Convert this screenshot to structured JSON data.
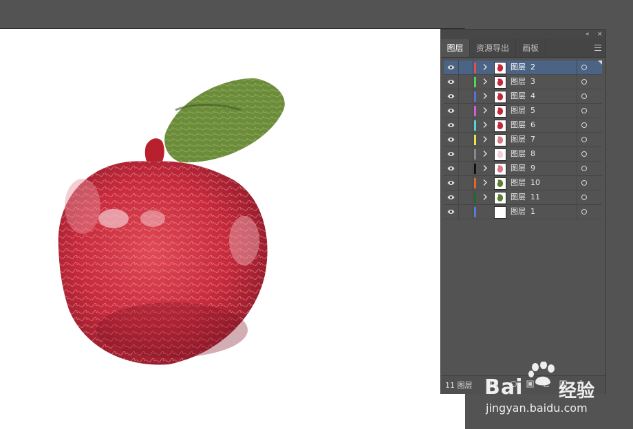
{
  "panel": {
    "controls": {
      "collapse": "«",
      "close": "×"
    },
    "tabs": [
      {
        "label": "图层",
        "active": true
      },
      {
        "label": "资源导出",
        "active": false
      },
      {
        "label": "画板",
        "active": false
      }
    ],
    "layers": [
      {
        "name": "图层  2",
        "color": "#e0524d",
        "selected": true,
        "expand": true,
        "thumb": "red"
      },
      {
        "name": "图层  3",
        "color": "#4fd84f",
        "selected": false,
        "expand": true,
        "thumb": "red"
      },
      {
        "name": "图层  4",
        "color": "#5a6fd8",
        "selected": false,
        "expand": true,
        "thumb": "red"
      },
      {
        "name": "图层  5",
        "color": "#d65bd8",
        "selected": false,
        "expand": true,
        "thumb": "red"
      },
      {
        "name": "图层  6",
        "color": "#4fd8d8",
        "selected": false,
        "expand": true,
        "thumb": "red"
      },
      {
        "name": "图层  7",
        "color": "#e6e64a",
        "selected": false,
        "expand": true,
        "thumb": "pink"
      },
      {
        "name": "图层  8",
        "color": "#8a8a8a",
        "selected": false,
        "expand": true,
        "thumb": "faint"
      },
      {
        "name": "图层  9",
        "color": "#111111",
        "selected": false,
        "expand": true,
        "thumb": "pink"
      },
      {
        "name": "图层  10",
        "color": "#e06a2a",
        "selected": false,
        "expand": true,
        "thumb": "green"
      },
      {
        "name": "图层  11",
        "color": "#1e6a2e",
        "selected": false,
        "expand": true,
        "thumb": "green"
      },
      {
        "name": "图层  1",
        "color": "#5a7ad8",
        "selected": false,
        "expand": false,
        "thumb": "blank"
      }
    ],
    "footer": {
      "count": "11  图层"
    }
  },
  "watermark": {
    "brand": "Bai",
    "brand2": "经验",
    "url": "jingyan.baidu.com"
  },
  "icons": [
    "eye-icon",
    "chevron-right-icon",
    "target-circle-icon",
    "panel-menu-icon",
    "paw-logo"
  ]
}
